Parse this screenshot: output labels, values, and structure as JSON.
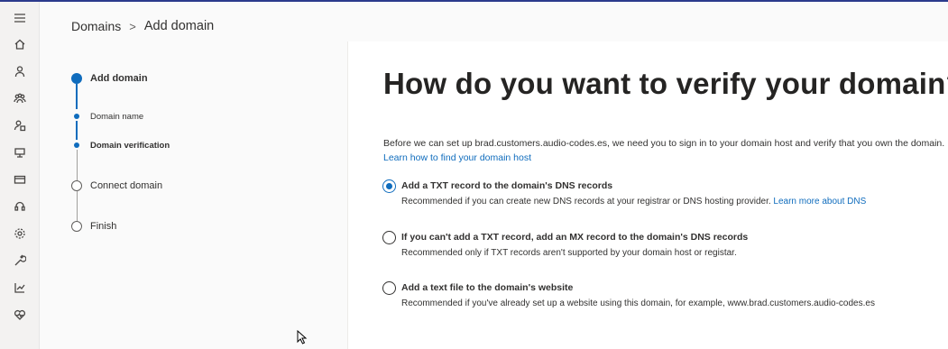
{
  "breadcrumb": {
    "parent": "Domains",
    "separator": ">",
    "current": "Add domain"
  },
  "nav_icons": [
    "menu-icon",
    "home-icon",
    "person-icon",
    "people-icon",
    "user-settings-icon",
    "devices-icon",
    "billing-icon",
    "support-icon",
    "settings-icon",
    "setup-icon",
    "reports-icon",
    "health-icon"
  ],
  "steps": [
    {
      "label": "Add domain",
      "state": "current"
    },
    {
      "label": "Domain name",
      "state": "done"
    },
    {
      "label": "Domain verification",
      "state": "current"
    },
    {
      "label": "Connect domain",
      "state": "pending"
    },
    {
      "label": "Finish",
      "state": "pending"
    }
  ],
  "page": {
    "title": "How do you want to verify your domain?",
    "intro": "Before we can set up brad.customers.audio-codes.es, we need you to sign in to your domain host and verify that you own the domain.",
    "learn_link": "Learn how to find your domain host"
  },
  "options": [
    {
      "title": "Add a TXT record to the domain's DNS records",
      "desc": "Recommended if you can create new DNS records at your registrar or DNS hosting provider.",
      "desc_link": "Learn more about DNS",
      "selected": true
    },
    {
      "title": "If you can't add a TXT record, add an MX record to the domain's DNS records",
      "desc": "Recommended only if TXT records aren't supported by your domain host or registar.",
      "desc_link": "",
      "selected": false
    },
    {
      "title": "Add a text file to the domain's website",
      "desc": "Recommended if you've already set up a website using this domain, for example, www.brad.customers.audio-codes.es",
      "desc_link": "",
      "selected": false
    }
  ],
  "colors": {
    "accent": "#0f6cbd",
    "rail_bg": "#f3f2f1",
    "top_bar": "#2b3a8c"
  }
}
